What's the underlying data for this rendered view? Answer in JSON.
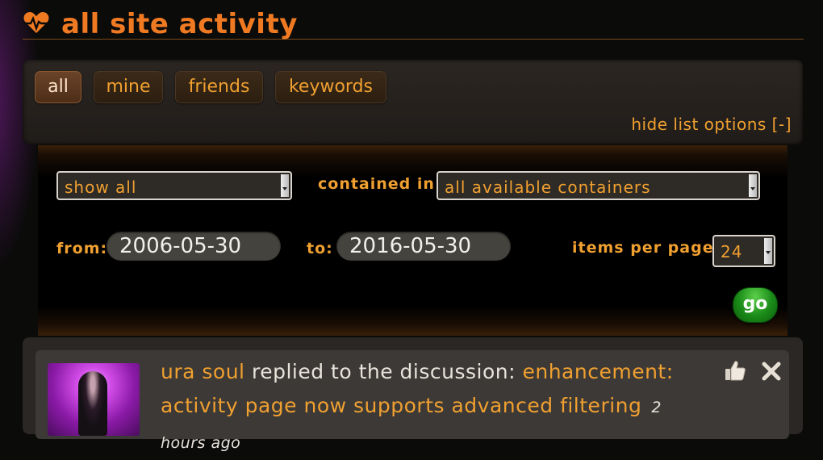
{
  "header": {
    "title": "all site activity",
    "icon": "heartbeat-icon"
  },
  "tabs": [
    {
      "label": "all",
      "active": true
    },
    {
      "label": "mine",
      "active": false
    },
    {
      "label": "friends",
      "active": false
    },
    {
      "label": "keywords",
      "active": false
    }
  ],
  "hide_list_options": "hide list options [-]",
  "filters": {
    "show_select": "show all",
    "contained_in_label": "contained in:",
    "contained_in_select": "all available containers",
    "from_label": "from:",
    "from_value": "2006-05-30",
    "to_label": "to:",
    "to_value": "2016-05-30",
    "items_per_page_label": "items per page:",
    "items_per_page_value": "24",
    "go_label": "go"
  },
  "activity": {
    "user": "ura soul",
    "action": " replied to the discussion: ",
    "topic": "enhancement: activity page now supports advanced filtering",
    "time": "2 hours ago",
    "icons": [
      "thumbs-up-icon",
      "close-icon"
    ]
  },
  "colors": {
    "accent": "#f07a22",
    "link": "#f0a030",
    "go": "#1a8a18"
  }
}
